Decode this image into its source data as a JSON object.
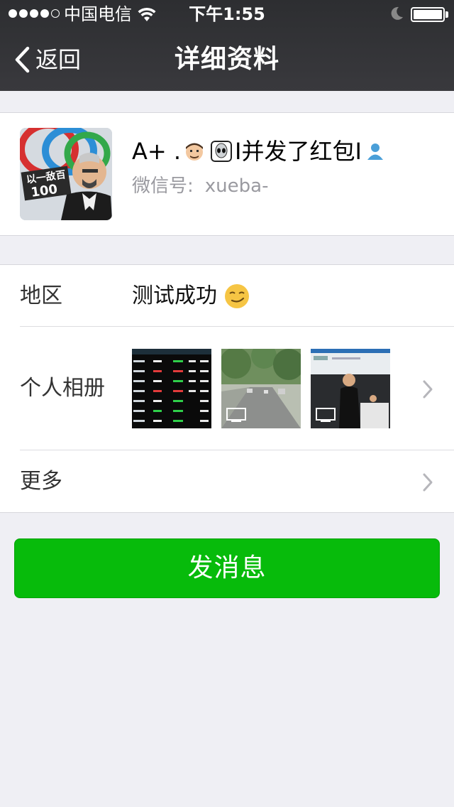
{
  "status_bar": {
    "carrier": "中国电信",
    "time": "下午1:55",
    "signal_bars_filled": 4,
    "signal_bars_total": 5,
    "battery_level": 1.0,
    "icons": [
      "wifi-icon",
      "moon-icon",
      "battery-icon"
    ]
  },
  "nav": {
    "back_label": "返回",
    "title": "详细资料",
    "back_icon": "chevron-left-icon"
  },
  "profile": {
    "nickname_prefix": "A+ .",
    "nickname_text": "I并发了红包I",
    "wechat_label": "微信号:",
    "wechat_id": "xueba-",
    "avatar_text": "以一敌百",
    "avatar_number": "100",
    "nickname_icons": [
      "man-face-emoji-icon",
      "alien-emoji-icon",
      "person-silhouette-icon"
    ]
  },
  "details": {
    "region_label": "地区",
    "region_value": "测试成功",
    "region_icon": "smirk-emoji-icon",
    "album_label": "个人相册",
    "album_photos": [
      "stock-table-photo",
      "street-photo",
      "classroom-photo"
    ],
    "more_label": "更多"
  },
  "actions": {
    "send_message": "发消息"
  },
  "colors": {
    "nav_bg": "#333438",
    "page_bg": "#efeff4",
    "button_green": "#07bb0b",
    "secondary_text": "#9a9aa0"
  }
}
